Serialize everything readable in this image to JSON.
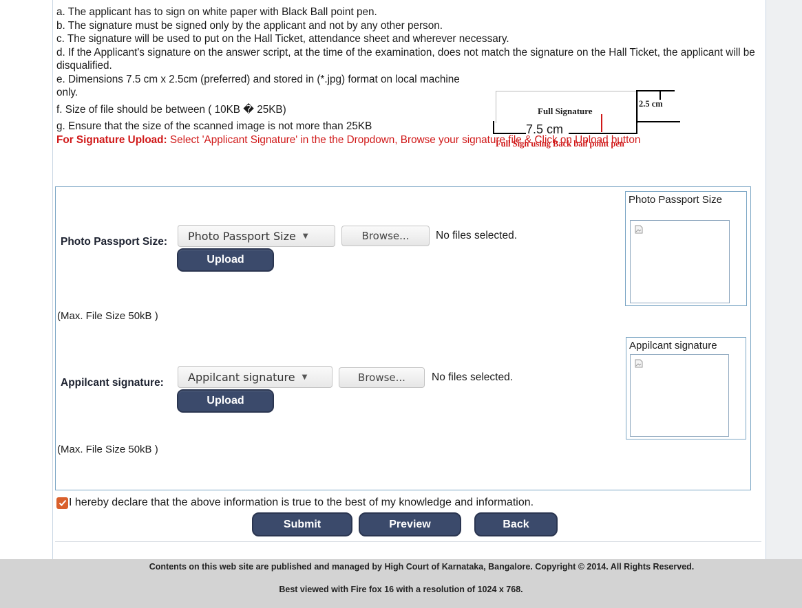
{
  "instructions": {
    "a": "a. The applicant has to sign on white paper with Black Ball point pen.",
    "b": "b. The signature must be signed only by the applicant and not by any other person.",
    "c": "c. The signature will be used to put on the Hall Ticket, attendance sheet and wherever necessary.",
    "d": "d. If the Applicant's signature on the answer script, at the time of the examination, does not match the signature on the Hall Ticket, the applicant will be disqualified.",
    "e": "e. Dimensions 7.5 cm x 2.5cm (preferred) and stored in (*.jpg) format on local machine only.",
    "f": "f. Size of file should be between ( 10KB � 25KB)",
    "g": "g. Ensure that the size of the scanned image is not more than 25KB",
    "upload_note_label": "For Signature Upload:",
    "upload_note_text": " Select 'Applicant Signature' in the the Dropdown, Browse your signature file & Click on Upload button"
  },
  "diagram": {
    "box_label": "Full Signature",
    "height_label": "2.5 cm",
    "width_label": "7.5 cm",
    "caption": "Full Sign using Back ball point pen"
  },
  "photo": {
    "label": "Photo Passport Size:",
    "max_size": "(Max. File Size 50kB )",
    "select_value": "Photo Passport Size",
    "browse_label": "Browse...",
    "file_status": "No files selected.",
    "upload_label": "Upload",
    "preview_title": "Photo Passport Size"
  },
  "signature": {
    "label": "Appilcant signature:",
    "max_size": "(Max. File Size 50kB )",
    "select_value": "Appilcant signature",
    "browse_label": "Browse...",
    "file_status": "No files selected.",
    "upload_label": "Upload",
    "preview_title": "Appilcant signature"
  },
  "declaration": {
    "checked": true,
    "text": "I hereby declare that the above information is true to the best of my knowledge and information."
  },
  "actions": {
    "submit": "Submit",
    "preview": "Preview",
    "back": "Back"
  },
  "footer": {
    "line1": "Contents on this web site are published and managed by High Court of Karnataka, Bangalore. Copyright © 2014. All Rights Reserved.",
    "line2": "Best viewed with Fire fox 16 with a resolution of 1024 x 768."
  },
  "colors": {
    "note_red": "#d01818",
    "button_navy": "#3b4a6b",
    "panel_border": "#7aa5c4",
    "footer_gray": "#d3d3d3",
    "checkbox_orange": "#d9602c"
  }
}
